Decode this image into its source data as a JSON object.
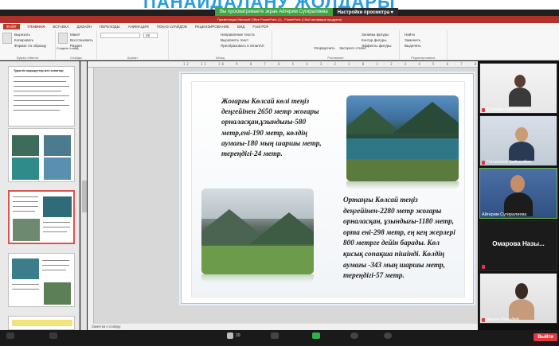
{
  "overlay": {
    "heading": "ПАНАЙДАЛАНУ ЖОЛДАРЫ"
  },
  "share": {
    "status": "Вы просматриваете экран Айгерим Сугиралиева",
    "settings": "Настройки просмотра ▾"
  },
  "app": {
    "title": "Презентация Microsoft Office PowerPoint (1) - PowerPoint (Сбой активации продукта)"
  },
  "ribbon": {
    "tabs": [
      "ФАЙЛ",
      "ГЛАВНАЯ",
      "ВСТАВКА",
      "ДИЗАЙН",
      "ПЕРЕХОДЫ",
      "АНИМАЦИЯ",
      "ПОКАЗ СЛАЙДОВ",
      "РЕЦЕНЗИРОВАНИЕ",
      "ВИД",
      "Foxit PDF"
    ],
    "clipboard": {
      "cut": "Вырезать",
      "copy": "Копировать",
      "format": "Формат по образцу",
      "label": "Буфер обмена"
    },
    "slides": {
      "new": "Создать слайд",
      "layout": "Макет",
      "reset": "Восстановить",
      "section": "Раздел",
      "label": "Слайды"
    },
    "font": {
      "label": "Шрифт",
      "size": "28"
    },
    "paragraph": {
      "dir": "Направление текста",
      "align": "Выровнять текст",
      "smartart": "Преобразовать в SmartArt",
      "label": "Абзац"
    },
    "drawing": {
      "arrange": "Упорядочить",
      "styles": "Экспресс-стили",
      "fill": "Заливка фигуры",
      "outline": "Контур фигуры",
      "effects": "Эффекты фигуры",
      "label": "Рисование"
    },
    "editing": {
      "find": "Найти",
      "replace": "Заменить",
      "select": "Выделить",
      "label": "Редактирование"
    }
  },
  "thumbnail_panel": {
    "first_title": "Туристік маршруттар мен сипаттар"
  },
  "slide": {
    "text1": "Жоғарғы Көлсай көлі теңіз деңгейінен 2650 метр жоғары орналасқан,ұзындығы-580 метр,ені-190 метр, көлдің аумағы-180 мың шаршы метр, тереңдігі-24 метр.",
    "text2": "Ортаңғы Көлсай теңіз деңгейінен-2280 метр жоғары орналасқан, ұзындығы-1180 метр, орта ені-298 метр, ең кең жерлері 800 метрге дейін барады. Көл қисық сопақша пішінді. Көлдің аумағы -343 мың шаршы метр, тереңдігі-57 метр."
  },
  "notes": {
    "placeholder": "Заметки к слайду"
  },
  "participants": [
    {
      "name": "Гүлнара Ушкулакова"
    },
    {
      "name": "Готыханов Бейсенбек"
    },
    {
      "name": "Айгерим Сугиралиева"
    },
    {
      "name": "Омарова Назы..."
    },
    {
      "name": "Ажжан Казыбей"
    }
  ],
  "toolbar": {
    "participants_count": "20",
    "leave": "Выйти"
  }
}
